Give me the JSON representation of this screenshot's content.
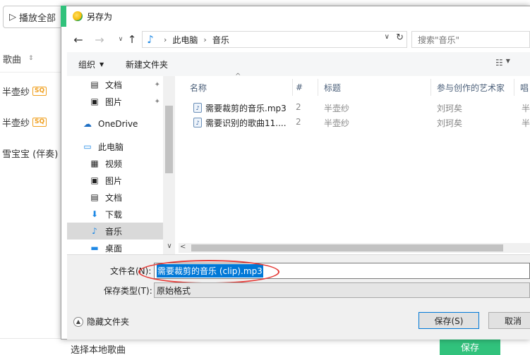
{
  "background_app": {
    "play_all": "播放全部",
    "song_header": "歌曲",
    "songs": [
      {
        "artist": "半壶纱",
        "badge": "SQ"
      },
      {
        "artist": "半壶纱",
        "badge": "SQ"
      },
      {
        "artist": "雪宝宝 (伴奏)",
        "badge": ""
      }
    ],
    "local_songs": "选择本地歌曲",
    "save_label": "保存"
  },
  "dialog": {
    "title": "另存为",
    "breadcrumb": [
      "此电脑",
      "音乐"
    ],
    "search_placeholder": "搜索\"音乐\"",
    "toolbar": {
      "organize": "组织",
      "new_folder": "新建文件夹"
    },
    "nav_items": [
      {
        "label": "文档",
        "icon": "document-icon",
        "pinned": true
      },
      {
        "label": "图片",
        "icon": "pictures-icon",
        "pinned": true
      },
      {
        "label": "OneDrive",
        "icon": "cloud-icon",
        "pinned": false
      },
      {
        "label": "此电脑",
        "icon": "computer-icon",
        "pinned": false
      },
      {
        "label": "视频",
        "icon": "video-icon",
        "pinned": false
      },
      {
        "label": "图片",
        "icon": "pictures-icon",
        "pinned": false
      },
      {
        "label": "文档",
        "icon": "document-icon",
        "pinned": false
      },
      {
        "label": "下载",
        "icon": "download-icon",
        "pinned": false
      },
      {
        "label": "音乐",
        "icon": "music-icon",
        "pinned": false,
        "selected": true
      },
      {
        "label": "桌面",
        "icon": "desktop-icon",
        "pinned": false
      }
    ],
    "columns": [
      "名称",
      "#",
      "标题",
      "参与创作的艺术家",
      "唱"
    ],
    "files": [
      {
        "name": "需要裁剪的音乐.mp3",
        "num": "2",
        "title": "半壶纱",
        "artist": "刘珂矣",
        "album": "半"
      },
      {
        "name": "需要识别的歌曲11....",
        "num": "2",
        "title": "半壶纱",
        "artist": "刘珂矣",
        "album": "半"
      }
    ],
    "filename_label": "文件名(N):",
    "filename_value": "需要裁剪的音乐 (clip).mp3",
    "filetype_label": "保存类型(T):",
    "filetype_value": "原始格式",
    "hide_folders": "隐藏文件夹",
    "save_button": "保存(S)",
    "cancel_button": "取消",
    "accent_color": "#31c27c",
    "selection_color": "#0078d7",
    "annotation_color": "#e53935"
  }
}
